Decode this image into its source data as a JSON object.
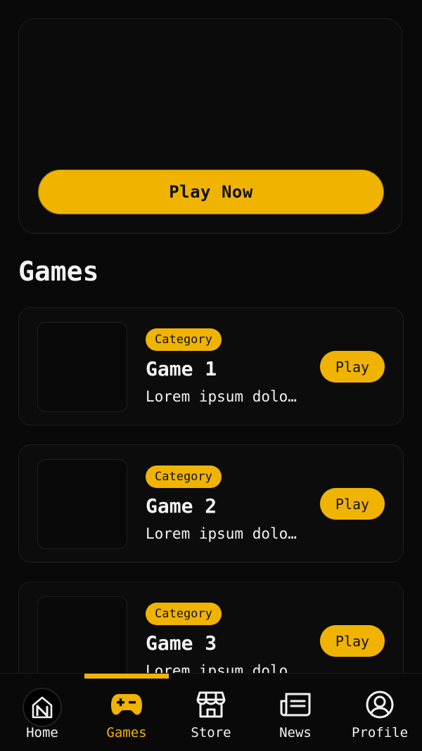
{
  "hero": {
    "play_label": "Play Now"
  },
  "section_title": "Games",
  "games": [
    {
      "category": "Category",
      "title": "Game 1",
      "description": "Lorem ipsum dolor sit amet",
      "play_label": "Play"
    },
    {
      "category": "Category",
      "title": "Game 2",
      "description": "Lorem ipsum dolor sit amet",
      "play_label": "Play"
    },
    {
      "category": "Category",
      "title": "Game 3",
      "description": "Lorem ipsum dolor sit amet",
      "play_label": "Play"
    }
  ],
  "tabs": [
    {
      "label": "Home",
      "icon": "home-logo-icon"
    },
    {
      "label": "Games",
      "icon": "gamepad-icon",
      "active": true
    },
    {
      "label": "Store",
      "icon": "store-icon"
    },
    {
      "label": "News",
      "icon": "newspaper-icon"
    },
    {
      "label": "Profile",
      "icon": "profile-icon"
    }
  ],
  "colors": {
    "accent": "#f0b400",
    "background": "#090909",
    "text": "#f2f2f2"
  }
}
